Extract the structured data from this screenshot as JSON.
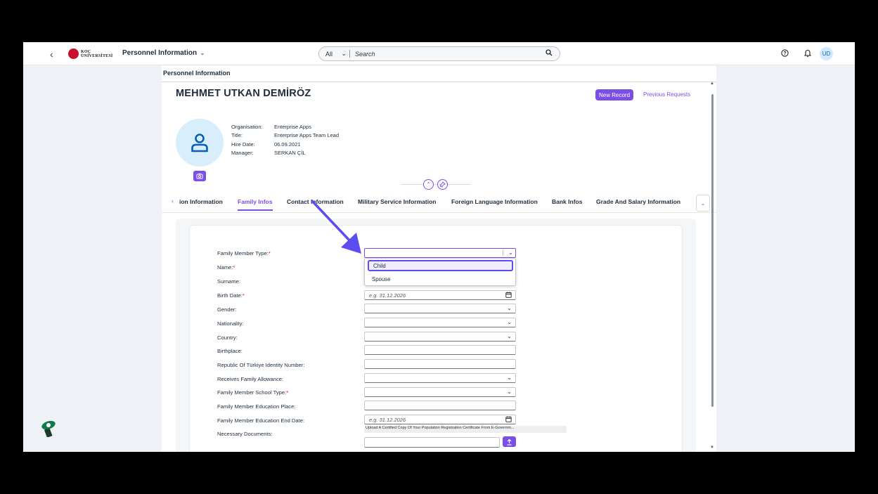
{
  "shell": {
    "back_icon": "chevron-left-icon",
    "logo_text_1": "KOÇ",
    "logo_text_2": "ÜNİVERSİTESİ",
    "app_title": "Personnel Information",
    "search_scope": "All",
    "search_placeholder": "Search",
    "avatar_initials": "UD"
  },
  "page": {
    "title": "Personnel Information",
    "employee_name": "MEHMET UTKAN DEMİRÖZ",
    "new_record_label": "New Record",
    "previous_requests_label": "Previous Requests",
    "info": [
      {
        "key": "Organisation:",
        "value": "Enterprise Apps"
      },
      {
        "key": "Title:",
        "value": "Enterprise Apps Team Lead"
      },
      {
        "key": "Hire Date:",
        "value": "06.09.2021"
      },
      {
        "key": "Manager:",
        "value": "SERKAN ÇİL"
      }
    ]
  },
  "tabs": [
    "ion Information",
    "Family Infos",
    "Contact Information",
    "Military Service Information",
    "Foreign Language Information",
    "Bank Infos",
    "Grade And Salary Information"
  ],
  "active_tab": "Family Infos",
  "form": {
    "fields": [
      {
        "label": "Family Member Type:",
        "required": true,
        "type": "select"
      },
      {
        "label": "Name:",
        "required": true,
        "type": "text"
      },
      {
        "label": "Surname:",
        "required": false,
        "type": "text"
      },
      {
        "label": "Birth Date:",
        "required": true,
        "type": "date",
        "placeholder": "e.g. 31.12.2026"
      },
      {
        "label": "Gender:",
        "required": false,
        "type": "select"
      },
      {
        "label": "Nationality:",
        "required": false,
        "type": "select"
      },
      {
        "label": "Country:",
        "required": false,
        "type": "select"
      },
      {
        "label": "Birthplace:",
        "required": false,
        "type": "text"
      },
      {
        "label": "Republic Of Türkiye Identity Number:",
        "required": false,
        "type": "text"
      },
      {
        "label": "Receives Family Allowance:",
        "required": false,
        "type": "select"
      },
      {
        "label": "Family Member School Type:",
        "required": true,
        "type": "select"
      },
      {
        "label": "Family Member Education Place:",
        "required": false,
        "type": "text"
      },
      {
        "label": "Family Member Education End Date:",
        "required": false,
        "type": "date",
        "placeholder": "e.g. 31.12.2026"
      },
      {
        "label": "Necessary Documents:",
        "required": false,
        "type": "upload"
      }
    ],
    "required_mark": "*",
    "family_member_type_options": [
      "Child",
      "Spouse"
    ],
    "highlighted_option": "Child",
    "documents_hint": "Upload A Certified Copy Of Your Population Registration Certificate From E-Governm..."
  },
  "colors": {
    "accent": "#7b4ee6",
    "annotation_arrow": "#5b4ef0",
    "avatar_bg": "#d9eefb"
  }
}
